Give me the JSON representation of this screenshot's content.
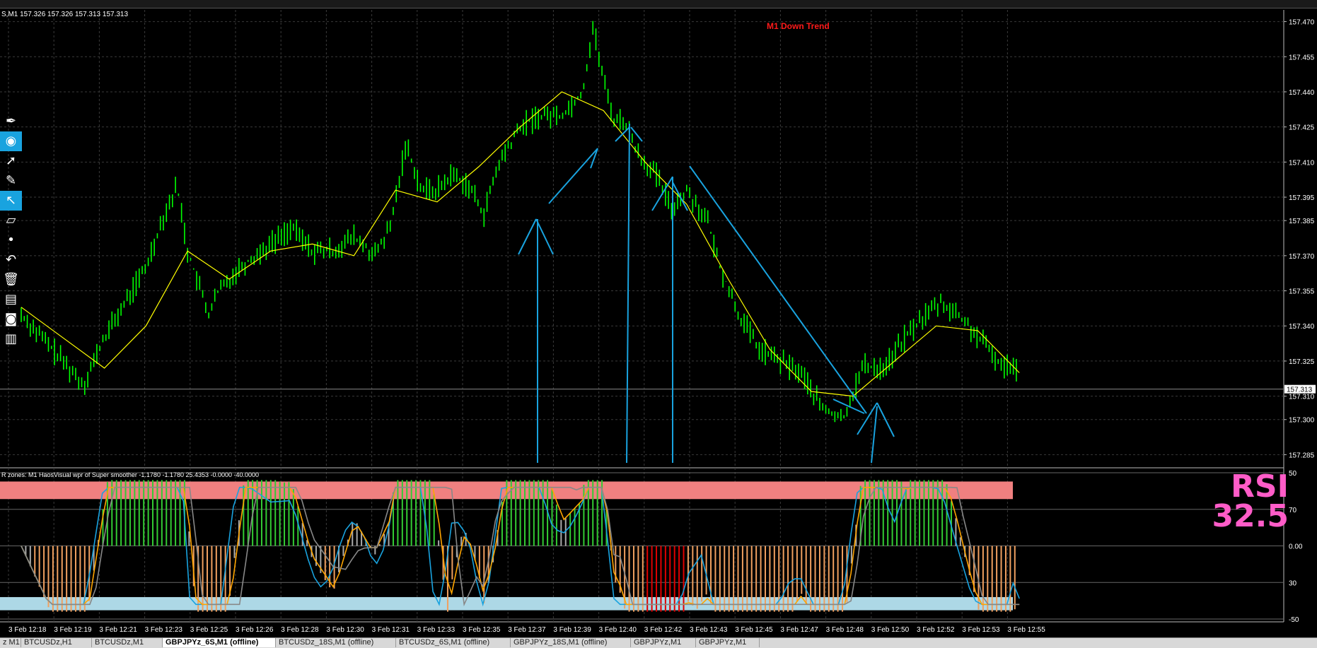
{
  "header": {
    "ohlc_text": "S,M1  157.326 157.326 157.313 157.313"
  },
  "annotation": {
    "trend_label": "M1 Down Trend"
  },
  "indicator": {
    "title": "R zones: M1 HaosVisual wpr of Super smoother -1.1780 -1.1780 25.4353 -0.0000 -40.0000",
    "rsi_label": "RSI",
    "rsi_value": "32.5"
  },
  "tabs": [
    {
      "label": "z M1",
      "active": false
    },
    {
      "label": "BTCUSDz,H1",
      "active": false
    },
    {
      "label": "BTCUSDz,M1",
      "active": false
    },
    {
      "label": "GBPJPYz_6S,M1 (offline)",
      "active": true
    },
    {
      "label": "BTCUSDz_18S,M1 (offline)",
      "active": false
    },
    {
      "label": "BTCUSDz_6S,M1 (offline)",
      "active": false
    },
    {
      "label": "GBPJPYz_18S,M1 (offline)",
      "active": false
    },
    {
      "label": "GBPJPYz,M1",
      "active": false
    },
    {
      "label": "GBPJPYz,M1",
      "active": false
    }
  ],
  "sidebar_tools": [
    {
      "icon": "pen-icon",
      "glyph": "✒",
      "selected": false
    },
    {
      "icon": "eye-icon",
      "glyph": "◉",
      "selected": true
    },
    {
      "icon": "cursor-icon",
      "glyph": "➚",
      "selected": false
    },
    {
      "icon": "tag-icon",
      "glyph": "✎",
      "selected": false
    },
    {
      "icon": "line-tool-icon",
      "glyph": "↖",
      "selected": true
    },
    {
      "icon": "ruler-icon",
      "glyph": "▱",
      "selected": false
    },
    {
      "icon": "dot-icon",
      "glyph": "•",
      "selected": false
    },
    {
      "icon": "undo-icon",
      "glyph": "↶",
      "selected": false
    },
    {
      "icon": "trash-icon",
      "glyph": "🗑",
      "selected": false
    },
    {
      "icon": "template-icon",
      "glyph": "▤",
      "selected": false
    },
    {
      "icon": "camera-icon",
      "glyph": "◙",
      "selected": false
    },
    {
      "icon": "clipboard-icon",
      "glyph": "▥",
      "selected": false
    }
  ],
  "chart_data": [
    {
      "type": "candlestick",
      "symbol": "GBPJPYz_6S",
      "timeframe": "M1",
      "y_ticks": [
        "157.470",
        "157.455",
        "157.440",
        "157.425",
        "157.410",
        "157.395",
        "157.385",
        "157.370",
        "157.355",
        "157.340",
        "157.325",
        "157.310",
        "157.300",
        "157.285"
      ],
      "ylim": [
        157.28,
        157.475
      ],
      "current_price": "157.313",
      "x_ticks": [
        "3 Feb 12:18",
        "3 Feb 12:19",
        "3 Feb 12:21",
        "3 Feb 12:23",
        "3 Feb 12:25",
        "3 Feb 12:26",
        "3 Feb 12:28",
        "3 Feb 12:30",
        "3 Feb 12:31",
        "3 Feb 12:33",
        "3 Feb 12:35",
        "3 Feb 12:37",
        "3 Feb 12:39",
        "3 Feb 12:40",
        "3 Feb 12:42",
        "3 Feb 12:43",
        "3 Feb 12:45",
        "3 Feb 12:47",
        "3 Feb 12:48",
        "3 Feb 12:50",
        "3 Feb 12:52",
        "3 Feb 12:53",
        "3 Feb 12:55"
      ],
      "price_path": [
        [
          0,
          157.345
        ],
        [
          0.02,
          157.335
        ],
        [
          0.04,
          157.325
        ],
        [
          0.06,
          157.315
        ],
        [
          0.08,
          157.335
        ],
        [
          0.1,
          157.35
        ],
        [
          0.12,
          157.365
        ],
        [
          0.135,
          157.385
        ],
        [
          0.15,
          157.4
        ],
        [
          0.16,
          157.372
        ],
        [
          0.18,
          157.345
        ],
        [
          0.19,
          157.355
        ],
        [
          0.21,
          157.365
        ],
        [
          0.24,
          157.375
        ],
        [
          0.26,
          157.382
        ],
        [
          0.28,
          157.372
        ],
        [
          0.3,
          157.372
        ],
        [
          0.32,
          157.378
        ],
        [
          0.34,
          157.37
        ],
        [
          0.355,
          157.382
        ],
        [
          0.37,
          157.418
        ],
        [
          0.385,
          157.398
        ],
        [
          0.4,
          157.398
        ],
        [
          0.415,
          157.405
        ],
        [
          0.43,
          157.4
        ],
        [
          0.445,
          157.388
        ],
        [
          0.46,
          157.41
        ],
        [
          0.48,
          157.425
        ],
        [
          0.5,
          157.43
        ],
        [
          0.52,
          157.43
        ],
        [
          0.54,
          157.44
        ],
        [
          0.55,
          157.468
        ],
        [
          0.56,
          157.445
        ],
        [
          0.57,
          157.428
        ],
        [
          0.58,
          157.428
        ],
        [
          0.595,
          157.412
        ],
        [
          0.61,
          157.405
        ],
        [
          0.625,
          157.39
        ],
        [
          0.64,
          157.398
        ],
        [
          0.66,
          157.385
        ],
        [
          0.67,
          157.368
        ],
        [
          0.69,
          157.345
        ],
        [
          0.71,
          157.33
        ],
        [
          0.73,
          157.325
        ],
        [
          0.75,
          157.32
        ],
        [
          0.77,
          157.305
        ],
        [
          0.79,
          157.3
        ],
        [
          0.81,
          157.323
        ],
        [
          0.83,
          157.322
        ],
        [
          0.85,
          157.335
        ],
        [
          0.87,
          157.345
        ],
        [
          0.885,
          157.35
        ],
        [
          0.9,
          157.345
        ],
        [
          0.915,
          157.338
        ],
        [
          0.93,
          157.33
        ],
        [
          0.945,
          157.322
        ],
        [
          0.955,
          157.325
        ],
        [
          0.96,
          157.318
        ]
      ],
      "moving_average": [
        [
          0,
          157.348
        ],
        [
          0.04,
          157.335
        ],
        [
          0.08,
          157.322
        ],
        [
          0.12,
          157.34
        ],
        [
          0.16,
          157.372
        ],
        [
          0.2,
          157.36
        ],
        [
          0.24,
          157.372
        ],
        [
          0.28,
          157.375
        ],
        [
          0.32,
          157.37
        ],
        [
          0.36,
          157.398
        ],
        [
          0.4,
          157.393
        ],
        [
          0.44,
          157.408
        ],
        [
          0.48,
          157.425
        ],
        [
          0.52,
          157.44
        ],
        [
          0.56,
          157.432
        ],
        [
          0.6,
          157.41
        ],
        [
          0.64,
          157.392
        ],
        [
          0.68,
          157.36
        ],
        [
          0.72,
          157.33
        ],
        [
          0.76,
          157.312
        ],
        [
          0.8,
          157.31
        ],
        [
          0.84,
          157.325
        ],
        [
          0.88,
          157.34
        ],
        [
          0.92,
          157.338
        ],
        [
          0.96,
          157.32
        ]
      ]
    },
    {
      "type": "line",
      "name": "oscillator",
      "y_ticks": [
        "50",
        "70",
        "0.00",
        "30",
        "-50"
      ],
      "ylim": [
        -50,
        50
      ],
      "levels": {
        "upper_zone": [
          32,
          44
        ],
        "lower_zone": [
          -44,
          -35
        ]
      }
    }
  ],
  "colors": {
    "background": "#000000",
    "grid": "#3a3a3a",
    "candle": "#00ff00",
    "ma": "#ffff00",
    "arrows": "#19a3df",
    "upper_zone": "#f08080",
    "lower_zone": "#add8e6",
    "rsi": "#ff5cc8"
  }
}
